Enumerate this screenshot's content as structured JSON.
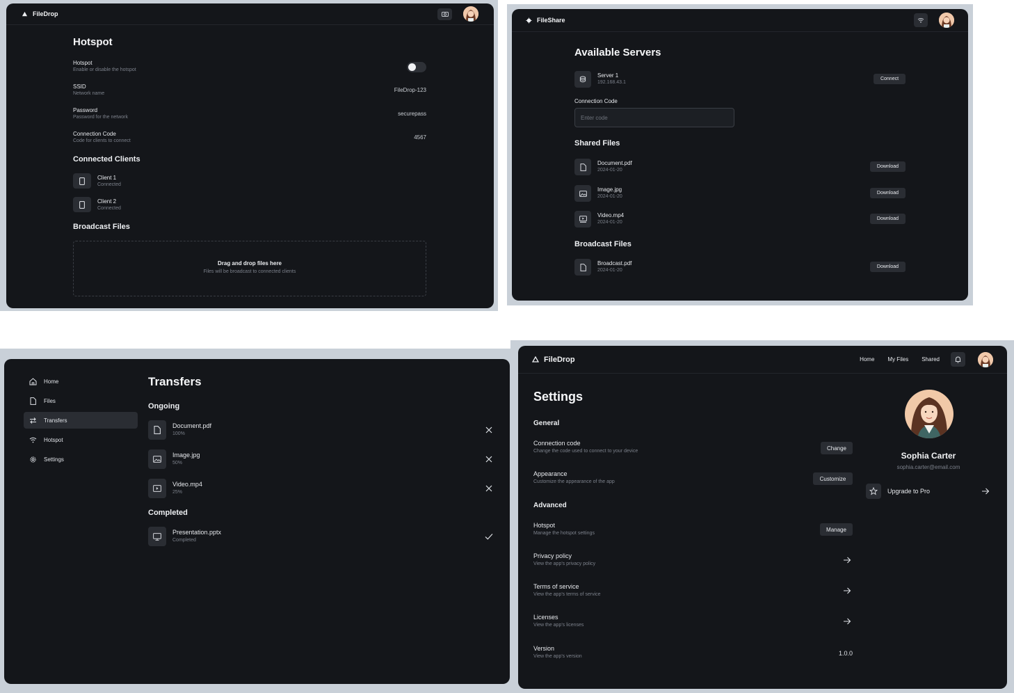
{
  "panel1": {
    "brand": "FileDrop",
    "title": "Hotspot",
    "settings": [
      {
        "label": "Hotspot",
        "desc": "Enable or disable the hotspot",
        "value": ""
      },
      {
        "label": "SSID",
        "desc": "Network name",
        "value": "FileDrop-123"
      },
      {
        "label": "Password",
        "desc": "Password for the network",
        "value": "securepass"
      },
      {
        "label": "Connection Code",
        "desc": "Code for clients to connect",
        "value": "4567"
      }
    ],
    "hotspot_enabled": false,
    "clients_title": "Connected Clients",
    "clients": [
      {
        "name": "Client 1",
        "status": "Connected"
      },
      {
        "name": "Client 2",
        "status": "Connected"
      }
    ],
    "broadcast_title": "Broadcast Files",
    "drop_title": "Drag and drop files here",
    "drop_desc": "Files will be broadcast to connected clients"
  },
  "panel2": {
    "brand": "FileShare",
    "title": "Available Servers",
    "server": {
      "name": "Server 1",
      "ip": "192.168.43.1",
      "button": "Connect"
    },
    "code_label": "Connection Code",
    "code_placeholder": "Enter code",
    "shared_title": "Shared Files",
    "shared": [
      {
        "name": "Document.pdf",
        "date": "2024-01-20",
        "button": "Download",
        "icon": "file-icon"
      },
      {
        "name": "Image.jpg",
        "date": "2024-01-20",
        "button": "Download",
        "icon": "image-icon"
      },
      {
        "name": "Video.mp4",
        "date": "2024-01-20",
        "button": "Download",
        "icon": "video-icon"
      }
    ],
    "broadcast_title": "Broadcast Files",
    "broadcast": [
      {
        "name": "Broadcast.pdf",
        "date": "2024-01-20",
        "button": "Download",
        "icon": "file-icon"
      }
    ]
  },
  "panel3": {
    "nav": [
      {
        "label": "Home",
        "icon": "home-icon",
        "active": false
      },
      {
        "label": "Files",
        "icon": "file-icon",
        "active": false
      },
      {
        "label": "Transfers",
        "icon": "transfer-icon",
        "active": true
      },
      {
        "label": "Hotspot",
        "icon": "wifi-icon",
        "active": false
      },
      {
        "label": "Settings",
        "icon": "gear-icon",
        "active": false
      }
    ],
    "title": "Transfers",
    "ongoing_title": "Ongoing",
    "ongoing": [
      {
        "name": "Document.pdf",
        "progress": "100%",
        "icon": "file-icon"
      },
      {
        "name": "Image.jpg",
        "progress": "50%",
        "icon": "image-icon"
      },
      {
        "name": "Video.mp4",
        "progress": "25%",
        "icon": "video-icon"
      }
    ],
    "completed_title": "Completed",
    "completed": [
      {
        "name": "Presentation.pptx",
        "status": "Completed",
        "icon": "presentation-icon"
      }
    ]
  },
  "panel4": {
    "brand": "FileDrop",
    "nav": [
      "Home",
      "My Files",
      "Shared"
    ],
    "title": "Settings",
    "general_title": "General",
    "general": [
      {
        "label": "Connection code",
        "desc": "Change the code used to connect to your device",
        "button": "Change"
      },
      {
        "label": "Appearance",
        "desc": "Customize the appearance of the app",
        "button": "Customize"
      }
    ],
    "advanced_title": "Advanced",
    "advanced": [
      {
        "label": "Hotspot",
        "desc": "Manage the hotspot settings",
        "button": "Manage"
      },
      {
        "label": "Privacy policy",
        "desc": "View the app's privacy policy",
        "button": ""
      },
      {
        "label": "Terms of service",
        "desc": "View the app's terms of service",
        "button": ""
      },
      {
        "label": "Licenses",
        "desc": "View the app's licenses",
        "button": ""
      }
    ],
    "version_label": "Version",
    "version_desc": "View the app's version",
    "version_value": "1.0.0",
    "profile": {
      "name": "Sophia Carter",
      "email": "sophia.carter@email.com",
      "upgrade": "Upgrade to Pro"
    }
  }
}
